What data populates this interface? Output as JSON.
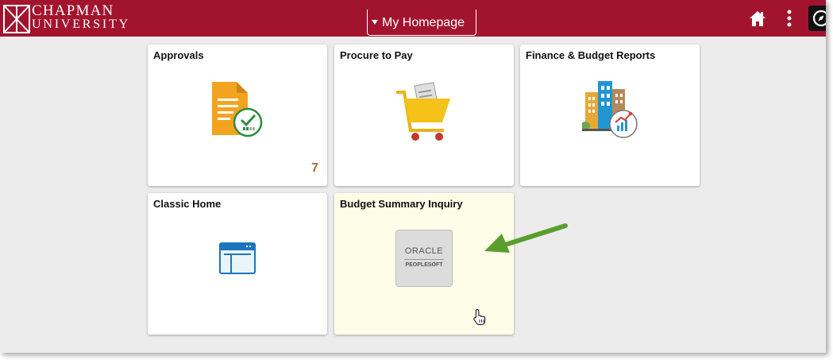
{
  "header": {
    "logo_line1": "CHAPMAN",
    "logo_line2": "UNIVERSITY",
    "homepage_label": "My Homepage",
    "home_icon": "home-icon",
    "menu_icon": "more-vertical-icon",
    "navbar_icon": "compass-icon"
  },
  "tiles": [
    {
      "title": "Approvals",
      "count": "7",
      "icon": "document-check-icon"
    },
    {
      "title": "Procure to Pay",
      "icon": "shopping-cart-icon"
    },
    {
      "title": "Finance & Budget Reports",
      "icon": "buildings-chart-icon"
    },
    {
      "title": "Classic Home",
      "icon": "browser-window-icon"
    },
    {
      "title": "Budget Summary Inquiry",
      "logo_line1": "ORACLE",
      "logo_line2": "PEOPLESOFT",
      "icon": "oracle-peoplesoft-logo"
    }
  ],
  "annotations": {
    "arrow": "green-arrow-icon",
    "cursor": "hand-pointer-icon"
  },
  "colors": {
    "banner": "#a2142e",
    "background": "#ececec",
    "tile": "#ffffff",
    "hover_tile": "#fefde8",
    "count": "#a6692e",
    "arrow": "#5a9e2e"
  }
}
